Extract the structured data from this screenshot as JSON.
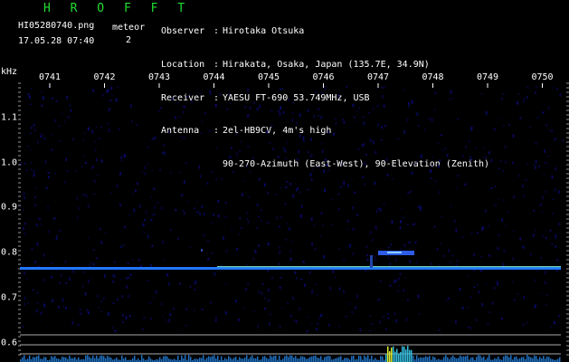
{
  "header": {
    "title": "H R O F F T",
    "filename": "HI05280740.png",
    "datetime": "17.05.28 07:40",
    "meteor_label": "meteor",
    "meteor_count": "2"
  },
  "info": [
    {
      "key": "Observer",
      "value": "Hirotaka Otsuka"
    },
    {
      "key": "Location",
      "value": "Hirakata, Osaka, Japan (135.7E, 34.9N)"
    },
    {
      "key": "Receiver",
      "value": "YAESU FT-690 53.749MHz, USB"
    },
    {
      "key": "Antenna",
      "value": "2el-HB9CV, 4m's high"
    },
    {
      "key": "",
      "value": "90-270-Azimuth (East-West), 90-Elevation (Zenith)"
    }
  ],
  "axis": {
    "unit": "kHz",
    "time_ticks": [
      "0741",
      "0742",
      "0743",
      "0744",
      "0745",
      "0746",
      "0747",
      "0748",
      "0749",
      "0750"
    ],
    "freq_ticks": [
      "1.1",
      "1.0",
      "0.9",
      "0.8",
      "0.7",
      "0.6"
    ]
  },
  "colors": {
    "title": "#22dd33",
    "carrier": "#2277ff",
    "carrier_core": "#88ffcc",
    "noise": "#0a0a66",
    "baseline": "#aaaaaa"
  }
}
